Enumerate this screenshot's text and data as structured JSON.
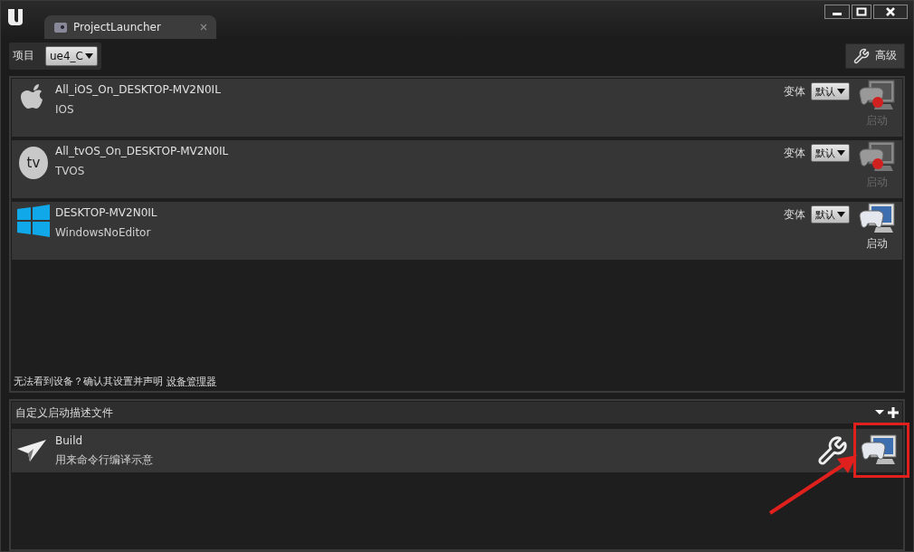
{
  "window": {
    "tab_title": "ProjectLauncher"
  },
  "toolbar": {
    "project_label": "项目",
    "project_value": "ue4_C",
    "advanced_button": "高级"
  },
  "devices": [
    {
      "kind": "ios",
      "name": "All_iOS_On_DESKTOP-MV2N0IL",
      "platform": "IOS",
      "variant_label": "变体",
      "variant_value": "默认",
      "launch_label": "启动",
      "disabled": true
    },
    {
      "kind": "tvos",
      "icon_text": "tv",
      "name": "All_tvOS_On_DESKTOP-MV2N0IL",
      "platform": "TVOS",
      "variant_label": "变体",
      "variant_value": "默认",
      "launch_label": "启动",
      "disabled": true
    },
    {
      "kind": "windows",
      "name": "DESKTOP-MV2N0IL",
      "platform": "WindowsNoEditor",
      "variant_label": "变体",
      "variant_value": "默认",
      "launch_label": "启动",
      "disabled": false
    }
  ],
  "device_hint": {
    "text": "无法看到设备？确认其设置并声明",
    "link": "设备管理器"
  },
  "profiles": {
    "title": "自定义启动描述文件",
    "items": [
      {
        "name": "Build",
        "description": "用来命令行编译示意",
        "highlighted": true
      }
    ]
  }
}
